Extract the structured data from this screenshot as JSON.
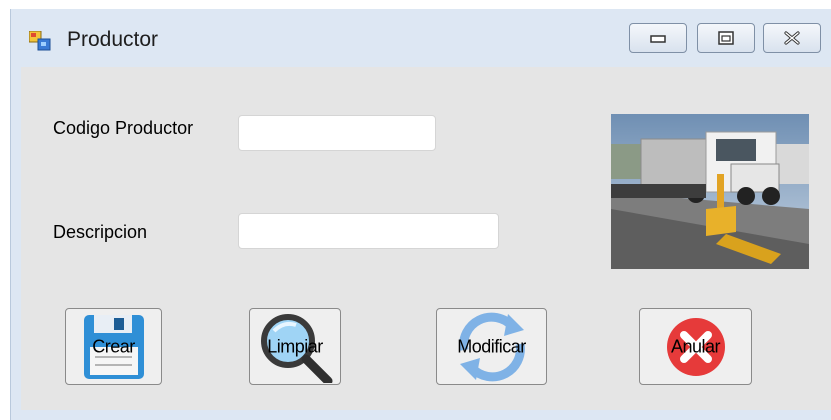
{
  "window": {
    "title": "Productor",
    "controls": {
      "minimize": "minimize-icon",
      "maximize": "maximize-icon",
      "close": "close-icon"
    }
  },
  "form": {
    "codigo_label": "Codigo Productor",
    "codigo_value": "",
    "descripcion_label": "Descripcion",
    "descripcion_value": ""
  },
  "photo": {
    "subject": "truck on weighbridge scale"
  },
  "buttons": {
    "crear": {
      "label": "Crear",
      "icon": "floppy-disk-icon"
    },
    "limpiar": {
      "label": "Limpiar",
      "icon": "magnifier-icon"
    },
    "modificar": {
      "label": "Modificar",
      "icon": "refresh-arrows-icon"
    },
    "anular": {
      "label": "Anular",
      "icon": "red-x-icon"
    }
  },
  "colors": {
    "titlebar": "#dde7f3",
    "client": "#e5e5e5",
    "cancel_red": "#e63a3a",
    "accent_blue": "#2f8fd6"
  }
}
